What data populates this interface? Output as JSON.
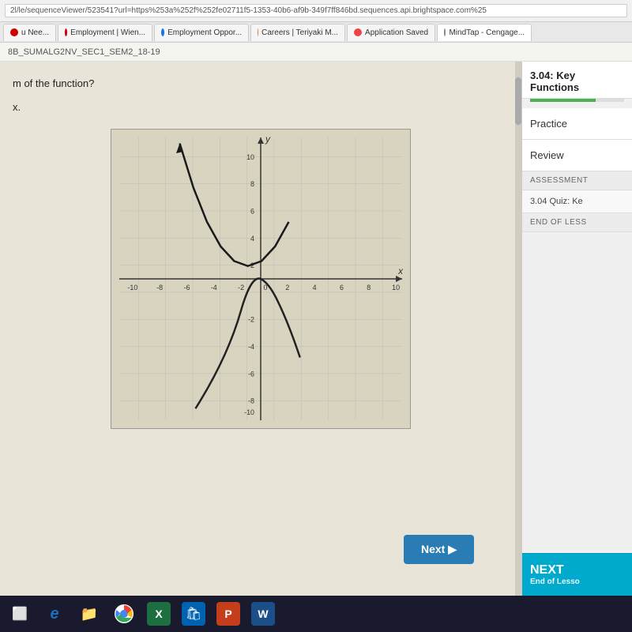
{
  "browser": {
    "url": "2l/le/sequenceViewer/523541?url=https%253a%252f%252fe02711f5-1353-40b6-af9b-349f7ff846bd.sequences.api.brightspace.com%25",
    "tabs": [
      {
        "id": "tab-nee",
        "label": "u Nee...",
        "icon": "red",
        "active": false
      },
      {
        "id": "tab-employment-wien",
        "label": "Employment | Wien...",
        "icon": "red",
        "active": false
      },
      {
        "id": "tab-employment-oppor",
        "label": "Employment Oppor...",
        "icon": "blue",
        "active": false
      },
      {
        "id": "tab-careers",
        "label": "Careers | Teriyaki M...",
        "icon": "orange",
        "active": false
      },
      {
        "id": "tab-application-saved",
        "label": "Application Saved",
        "icon": "flame",
        "active": false
      },
      {
        "id": "tab-mindtap",
        "label": "MindTap - Cengage...",
        "icon": "gear",
        "active": true
      }
    ]
  },
  "breadcrumb": {
    "text": "8B_SUMALG2NV_SEC1_SEM2_18-19"
  },
  "sidebar": {
    "title_line1": "3.04: Key",
    "title_line2": "Functions",
    "progress_percent": 70,
    "items": [
      {
        "id": "practice",
        "label": "Practice"
      },
      {
        "id": "review",
        "label": "Review"
      }
    ],
    "assessment_label": "Assessment",
    "sub_item": "3.04 Quiz: Ke",
    "end_of_lesson_label": "END OF LESS",
    "next_button_label": "NEXT",
    "next_button_sub": "End of Lesso"
  },
  "question": {
    "text": "m of the function?",
    "answer_label": "x."
  },
  "next_button": {
    "label": "Next ▶"
  },
  "graph": {
    "x_min": -10,
    "x_max": 10,
    "y_min": -10,
    "y_max": 10,
    "x_label": "x",
    "y_label": "y",
    "x_ticks": [
      -10,
      -8,
      -6,
      -4,
      -2,
      0,
      2,
      4,
      6,
      8,
      10
    ],
    "y_ticks": [
      10,
      8,
      6,
      4,
      2,
      0,
      -2,
      -4,
      -6,
      -8,
      -10
    ]
  },
  "taskbar": {
    "icons": [
      {
        "id": "monitor",
        "symbol": "⬜",
        "label": "monitor-icon"
      },
      {
        "id": "ie",
        "symbol": "e",
        "label": "ie-icon"
      },
      {
        "id": "explorer",
        "symbol": "📁",
        "label": "file-explorer-icon"
      },
      {
        "id": "chrome",
        "symbol": "⬤",
        "label": "chrome-icon"
      },
      {
        "id": "excel",
        "symbol": "X",
        "label": "excel-icon"
      },
      {
        "id": "store",
        "symbol": "🛍",
        "label": "store-icon"
      },
      {
        "id": "ppt",
        "symbol": "P",
        "label": "powerpoint-icon"
      },
      {
        "id": "word",
        "symbol": "W",
        "label": "word-icon"
      }
    ]
  }
}
